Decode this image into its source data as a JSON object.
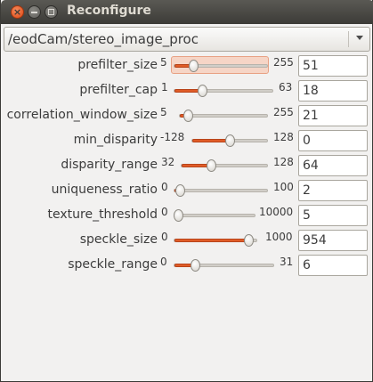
{
  "window": {
    "title": "Reconfigure",
    "close_glyph": "×",
    "node_path": "/eodCam/stereo_image_proc"
  },
  "params": [
    {
      "name": "prefilter_size",
      "min": "5",
      "max": "255",
      "value": "51",
      "slider_fraction": 0.18,
      "focused": true
    },
    {
      "name": "prefilter_cap",
      "min": "1",
      "max": "63",
      "value": "18",
      "slider_fraction": 0.27
    },
    {
      "name": "correlation_window_size",
      "min": "5",
      "max": "255",
      "value": "21",
      "slider_fraction": 0.06
    },
    {
      "name": "min_disparity",
      "min": "-128",
      "max": "128",
      "value": "0",
      "slider_fraction": 0.5
    },
    {
      "name": "disparity_range",
      "min": "32",
      "max": "128",
      "value": "64",
      "slider_fraction": 0.33
    },
    {
      "name": "uniqueness_ratio",
      "min": "0",
      "max": "100",
      "value": "2",
      "slider_fraction": 0.02
    },
    {
      "name": "texture_threshold",
      "min": "0",
      "max": "10000",
      "value": "5",
      "slider_fraction": 0.0
    },
    {
      "name": "speckle_size",
      "min": "0",
      "max": "1000",
      "value": "954",
      "slider_fraction": 0.954
    },
    {
      "name": "speckle_range",
      "min": "0",
      "max": "31",
      "value": "6",
      "slider_fraction": 0.19
    }
  ]
}
